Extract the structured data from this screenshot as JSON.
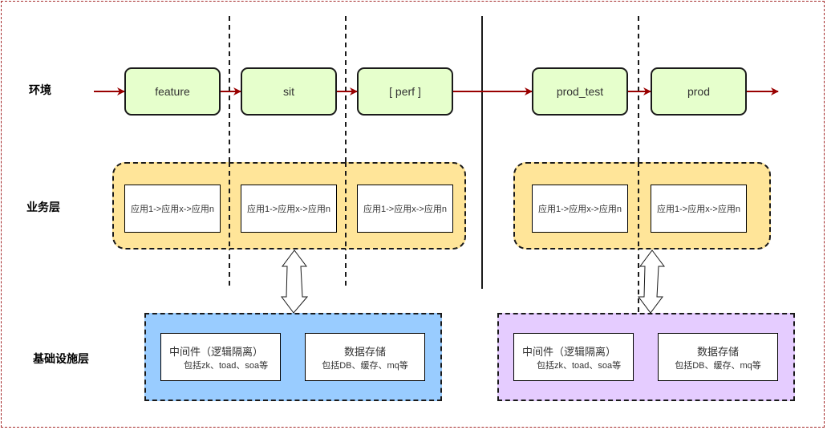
{
  "row_labels": {
    "environment": "环境",
    "business": "业务层",
    "infrastructure": "基础设施层"
  },
  "environments": [
    {
      "label": "feature"
    },
    {
      "label": "sit"
    },
    {
      "label": "[ perf ]"
    },
    {
      "label": "prod_test"
    },
    {
      "label": "prod"
    }
  ],
  "business_apps": [
    {
      "label": "应用1->应用x->应用n"
    },
    {
      "label": "应用1->应用x->应用n"
    },
    {
      "label": "应用1->应用x->应用n"
    },
    {
      "label": "应用1->应用x->应用n"
    },
    {
      "label": "应用1->应用x->应用n"
    }
  ],
  "infrastructure": {
    "left": {
      "color": "#99ccff",
      "middleware": {
        "title": "中间件（逻辑隔离）",
        "subtitle": "包括zk、toad、soa等"
      },
      "storage": {
        "title": "数据存储",
        "subtitle": "包括DB、缓存、mq等"
      }
    },
    "right": {
      "color": "#e5ccff",
      "middleware": {
        "title": "中间件（逻辑隔离）",
        "subtitle": "包括zk、toad、soa等"
      },
      "storage": {
        "title": "数据存储",
        "subtitle": "包括DB、缓存、mq等"
      }
    }
  },
  "colors": {
    "env_fill": "#e6ffcc",
    "business_fill": "#ffe599",
    "flow_arrow": "#990000",
    "frame_border": "#a52a2a"
  }
}
